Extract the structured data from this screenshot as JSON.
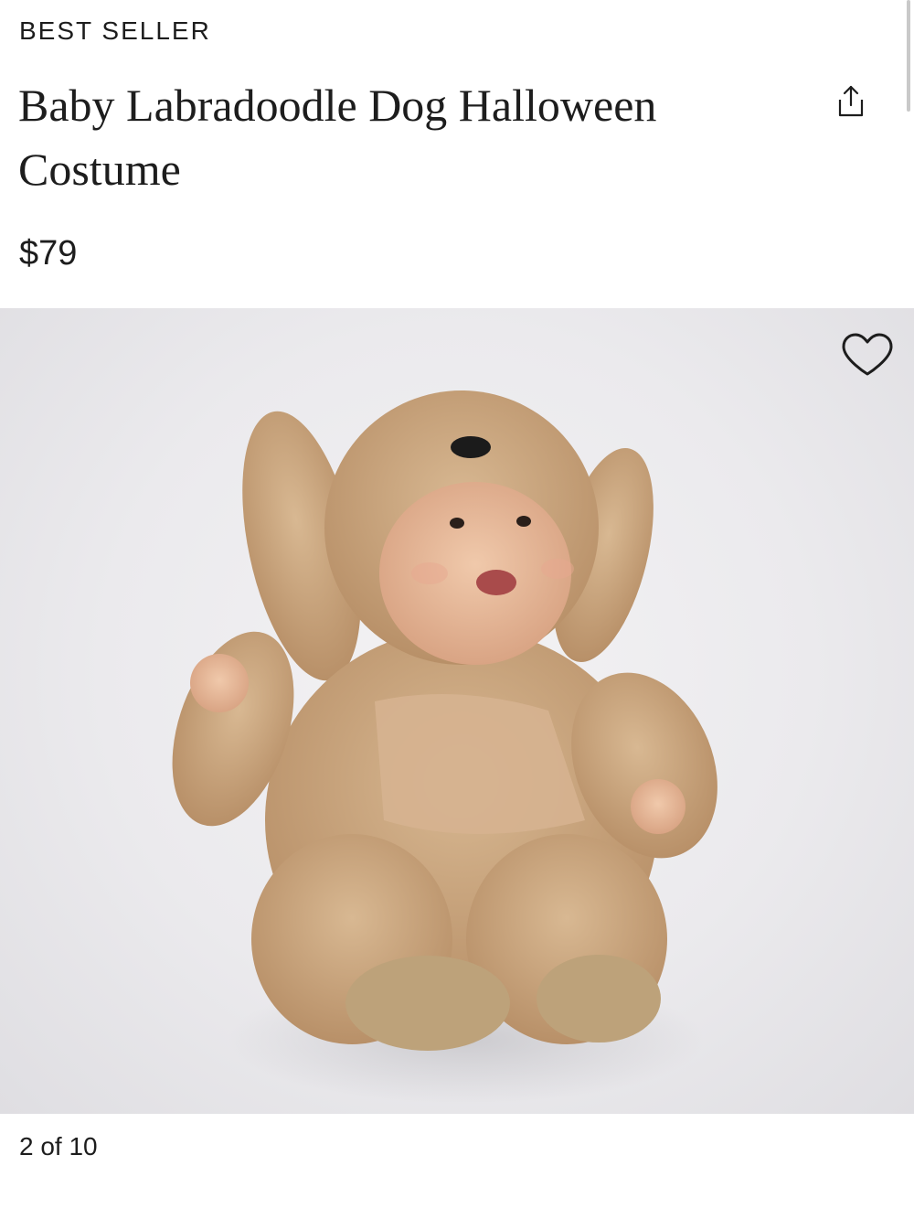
{
  "product": {
    "badge": "BEST SELLER",
    "title": "Baby Labradoodle Dog Halloween Costume",
    "price": "$79"
  },
  "gallery": {
    "current": 2,
    "total": 10,
    "counter_text": "2 of 10"
  },
  "icons": {
    "share": "share-icon",
    "favorite": "heart-outline-icon"
  },
  "colors": {
    "text": "#1d1d1d",
    "background": "#ffffff",
    "gallery_bg": "#ebeaed",
    "costume_fur": "#c4a07a",
    "costume_suede": "#d3b08c"
  }
}
